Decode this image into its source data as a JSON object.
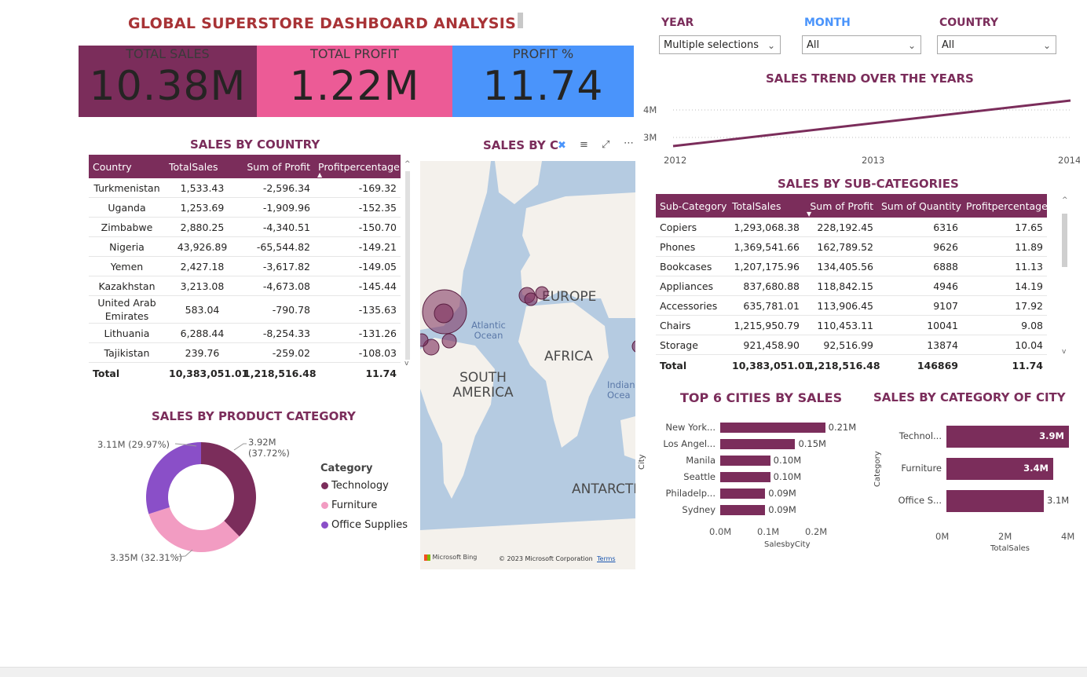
{
  "dashboard": {
    "title": "GLOBAL SUPERSTORE DASHBOARD ANALYSIS"
  },
  "kpis": [
    {
      "label": "TOTAL SALES",
      "value": "10.38M",
      "color": "#7b2d5b"
    },
    {
      "label": "TOTAL PROFIT",
      "value": "1.22M",
      "color": "#ec5b96"
    },
    {
      "label": "PROFIT %",
      "value": "11.74",
      "color": "#4a94fb"
    }
  ],
  "slicers": {
    "year": {
      "label": "YEAR",
      "value": "Multiple selections",
      "color": "#7b2d5b"
    },
    "month": {
      "label": "MONTH",
      "value": "All",
      "color": "#4a94fb"
    },
    "country": {
      "label": "COUNTRY",
      "value": "All",
      "color": "#7b2d5b"
    }
  },
  "trend": {
    "title": "SALES TREND OVER THE YEARS",
    "y_ticks": [
      "4M",
      "3M"
    ],
    "x_ticks": [
      "2012",
      "2013",
      "2014"
    ]
  },
  "country_table": {
    "title": "SALES BY COUNTRY",
    "headers": [
      "Country",
      "TotalSales",
      "Sum of Profit",
      "Profitpercentage"
    ],
    "rows": [
      [
        "Turkmenistan",
        "1,533.43",
        "-2,596.34",
        "-169.32"
      ],
      [
        "Uganda",
        "1,253.69",
        "-1,909.96",
        "-152.35"
      ],
      [
        "Zimbabwe",
        "2,880.25",
        "-4,340.51",
        "-150.70"
      ],
      [
        "Nigeria",
        "43,926.89",
        "-65,544.82",
        "-149.21"
      ],
      [
        "Yemen",
        "2,427.18",
        "-3,617.82",
        "-149.05"
      ],
      [
        "Kazakhstan",
        "3,213.08",
        "-4,673.08",
        "-145.44"
      ],
      [
        "United Arab Emirates",
        "583.04",
        "-790.78",
        "-135.63"
      ],
      [
        "Lithuania",
        "6,288.44",
        "-8,254.33",
        "-131.26"
      ],
      [
        "Tajikistan",
        "239.76",
        "-259.02",
        "-108.03"
      ]
    ],
    "total": [
      "Total",
      "10,383,051.01",
      "1,218,516.48",
      "11.74"
    ]
  },
  "map": {
    "title": "SALES BY C",
    "labels": {
      "europe": "EUROPE",
      "africa": "AFRICA",
      "south_america": "SOUTH AMERICA",
      "antarctica": "ANTARCTI",
      "atlantic": "Atlantic Ocean",
      "indian": "Indian Ocea"
    },
    "brand": "Microsoft Bing",
    "copyright": "© 2023 Microsoft Corporation",
    "terms": "Terms"
  },
  "subcat_table": {
    "title": "SALES BY SUB-CATEGORIES",
    "headers": [
      "Sub-Category",
      "TotalSales",
      "Sum of Profit",
      "Sum of Quantity",
      "Profitpercentage"
    ],
    "rows": [
      [
        "Copiers",
        "1,293,068.38",
        "228,192.45",
        "6316",
        "17.65"
      ],
      [
        "Phones",
        "1,369,541.66",
        "162,789.52",
        "9626",
        "11.89"
      ],
      [
        "Bookcases",
        "1,207,175.96",
        "134,405.56",
        "6888",
        "11.13"
      ],
      [
        "Appliances",
        "837,680.88",
        "118,842.15",
        "4946",
        "14.19"
      ],
      [
        "Accessories",
        "635,781.01",
        "113,906.45",
        "9107",
        "17.92"
      ],
      [
        "Chairs",
        "1,215,950.79",
        "110,453.11",
        "10041",
        "9.08"
      ],
      [
        "Storage",
        "921,458.90",
        "92,516.99",
        "13874",
        "10.04"
      ]
    ],
    "total": [
      "Total",
      "10,383,051.01",
      "1,218,516.48",
      "146869",
      "11.74"
    ]
  },
  "product_category": {
    "title": "SALES BY PRODUCT CATEGORY",
    "legend_title": "Category",
    "slices": [
      {
        "name": "Technology",
        "value": 37.72,
        "label": "3.92M",
        "pct": "(37.72%)",
        "color": "#7b2d5b"
      },
      {
        "name": "Furniture",
        "value": 32.31,
        "label": "3.35M (32.31%)",
        "color": "#f29cc2"
      },
      {
        "name": "Office Supplies",
        "value": 29.97,
        "label": "3.11M (29.97%)",
        "color": "#8a4fc8"
      }
    ]
  },
  "top_cities": {
    "title": "TOP 6 CITIES BY SALES",
    "ylabel": "City",
    "xlabel": "SalesbyCity",
    "x_ticks": [
      "0.0M",
      "0.1M",
      "0.2M"
    ],
    "xmax": 0.22,
    "bars": [
      {
        "city": "New York...",
        "value": 0.21,
        "label": "0.21M"
      },
      {
        "city": "Los Angel...",
        "value": 0.15,
        "label": "0.15M"
      },
      {
        "city": "Manila",
        "value": 0.1,
        "label": "0.10M"
      },
      {
        "city": "Seattle",
        "value": 0.1,
        "label": "0.10M"
      },
      {
        "city": "Philadelp...",
        "value": 0.09,
        "label": "0.09M"
      },
      {
        "city": "Sydney",
        "value": 0.09,
        "label": "0.09M"
      }
    ]
  },
  "category_city": {
    "title": "SALES BY CATEGORY OF CITY",
    "ylabel": "Category",
    "xlabel": "TotalSales",
    "x_ticks": [
      "0M",
      "2M",
      "4M"
    ],
    "xmax": 4,
    "bars": [
      {
        "name": "Technol...",
        "value": 3.9,
        "label": "3.9M"
      },
      {
        "name": "Furniture",
        "value": 3.4,
        "label": "3.4M"
      },
      {
        "name": "Office S...",
        "value": 3.1,
        "label": "3.1M"
      }
    ]
  },
  "chart_data": [
    {
      "type": "line",
      "title": "SALES TREND OVER THE YEARS",
      "x": [
        "2012",
        "2014"
      ],
      "y_ticks": [
        "3M",
        "4M"
      ],
      "series": [
        {
          "values": [
            2.9,
            4.2
          ]
        }
      ]
    },
    {
      "type": "pie",
      "title": "SALES BY PRODUCT CATEGORY",
      "categories": [
        "Technology",
        "Furniture",
        "Office Supplies"
      ],
      "values": [
        3.92,
        3.35,
        3.11
      ],
      "percentages": [
        37.72,
        32.31,
        29.97
      ]
    },
    {
      "type": "bar",
      "title": "TOP 6 CITIES BY SALES",
      "categories": [
        "New York...",
        "Los Angel...",
        "Manila",
        "Seattle",
        "Philadelp...",
        "Sydney"
      ],
      "values": [
        0.21,
        0.15,
        0.1,
        0.1,
        0.09,
        0.09
      ],
      "xlabel": "SalesbyCity",
      "ylabel": "City",
      "xlim": [
        0,
        0.22
      ]
    },
    {
      "type": "bar",
      "title": "SALES BY CATEGORY OF CITY",
      "categories": [
        "Technol...",
        "Furniture",
        "Office S..."
      ],
      "values": [
        3.9,
        3.4,
        3.1
      ],
      "xlabel": "TotalSales",
      "ylabel": "Category",
      "xlim": [
        0,
        4
      ]
    }
  ]
}
